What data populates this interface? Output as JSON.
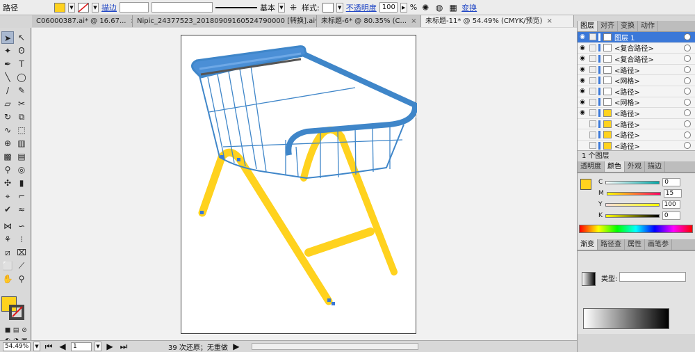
{
  "control_bar": {
    "mode_label": "路径",
    "stroke_link": "描边",
    "stroke_preset": "基本",
    "style_label": "样式:",
    "opacity_link": "不透明度",
    "opacity_value": "100",
    "opacity_unit": "%",
    "transform_link": "变换"
  },
  "tabs": [
    {
      "label": "C06000387.ai* @ 16.67..."
    },
    {
      "label": "Nipic_24377523_20180909160524790000 [转换].ai*..."
    },
    {
      "label": "未标题-6* @ 80.35% (C..."
    },
    {
      "label": "未标题-11* @ 54.49% (CMYK/预览)"
    }
  ],
  "status_bar": {
    "zoom": "54.49%",
    "page": "1",
    "message": "39 次还原；无重做"
  },
  "layers_panel": {
    "tabs": [
      "图层",
      "对齐",
      "变换",
      "动作"
    ],
    "layer_name": "图层 1",
    "items": [
      "<复合路径>",
      "<复合路径>",
      "<路径>",
      "<网格>",
      "<路径>",
      "<网格>",
      "<路径>",
      "<路径>",
      "<路径>",
      "<路径>"
    ],
    "footer": "1 个图层"
  },
  "color_panel": {
    "tabs": [
      "透明度",
      "颜色",
      "外观",
      "描边"
    ],
    "channels": [
      {
        "label": "C",
        "value": "0"
      },
      {
        "label": "M",
        "value": "15"
      },
      {
        "label": "Y",
        "value": "100"
      },
      {
        "label": "K",
        "value": "0"
      }
    ]
  },
  "gradient_panel": {
    "tabs": [
      "渐变",
      "路径查",
      "属性",
      "画笔参"
    ],
    "type_label": "类型:"
  },
  "colors": {
    "fill": "#ffd21e",
    "basket_blue": "#3f86c9",
    "leg_yellow": "#ffd21e"
  }
}
